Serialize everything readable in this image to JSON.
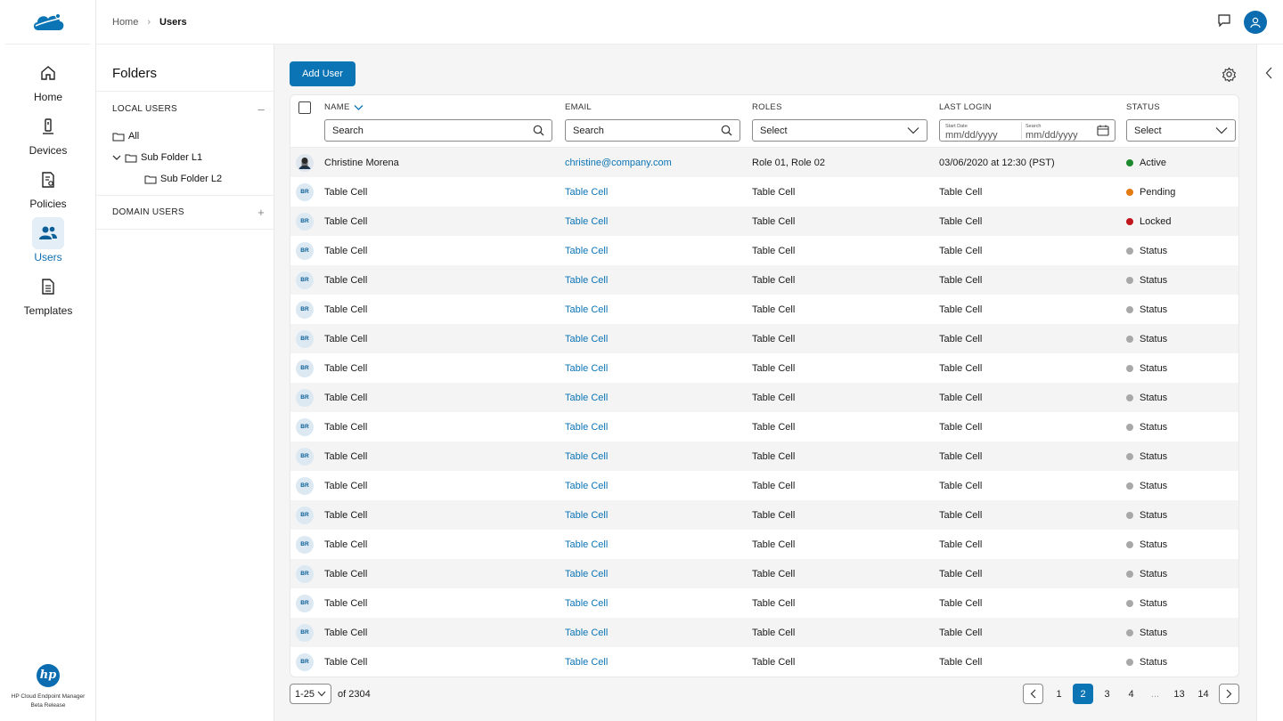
{
  "breadcrumb": {
    "home": "Home",
    "current": "Users"
  },
  "nav": {
    "items": [
      {
        "label": "Home",
        "icon": "home-icon"
      },
      {
        "label": "Devices",
        "icon": "device-icon"
      },
      {
        "label": "Policies",
        "icon": "policy-icon"
      },
      {
        "label": "Users",
        "icon": "users-icon",
        "active": true
      },
      {
        "label": "Templates",
        "icon": "template-icon"
      }
    ],
    "footer_line1": "HP Cloud Endpoint Manager",
    "footer_line2": "Beta Release",
    "footer_logo": "hp"
  },
  "folders": {
    "title": "Folders",
    "local_label": "LOCAL USERS",
    "local_toggle": "–",
    "nodes": [
      "All",
      "Sub Folder L1",
      "Sub Folder L2"
    ],
    "domain_label": "DOMAIN USERS",
    "domain_toggle": "+"
  },
  "toolbar": {
    "add_user": "Add User"
  },
  "table": {
    "headers": {
      "name": "NAME",
      "email": "EMAIL",
      "roles": "ROLES",
      "last_login": "LAST LOGIN",
      "status": "STATUS"
    },
    "filters": {
      "name": "Search",
      "email": "Search",
      "roles": "Select",
      "start_label": "Start Date",
      "start_value": "mm/dd/yyyy",
      "end_label": "Search",
      "end_value": "mm/dd/yyyy",
      "status": "Select"
    },
    "rows": [
      {
        "initials": "",
        "photo": true,
        "name": "Christine Morena",
        "email": "christine@company.com",
        "roles": "Role 01, Role 02",
        "last_login": "03/06/2020 at 12:30 (PST)",
        "status": "Active",
        "status_color": "#1e8a2e"
      },
      {
        "initials": "BR",
        "name": "Table Cell",
        "email": "Table Cell",
        "roles": "Table Cell",
        "last_login": "Table Cell",
        "status": "Pending",
        "status_color": "#e37a12"
      },
      {
        "initials": "BR",
        "name": "Table Cell",
        "email": "Table Cell",
        "roles": "Table Cell",
        "last_login": "Table Cell",
        "status": "Locked",
        "status_color": "#c0161c"
      },
      {
        "initials": "BR",
        "name": "Table Cell",
        "email": "Table Cell",
        "roles": "Table Cell",
        "last_login": "Table Cell",
        "status": "Status",
        "status_color": "#a8a8a8"
      },
      {
        "initials": "BR",
        "name": "Table Cell",
        "email": "Table Cell",
        "roles": "Table Cell",
        "last_login": "Table Cell",
        "status": "Status",
        "status_color": "#a8a8a8"
      },
      {
        "initials": "BR",
        "name": "Table Cell",
        "email": "Table Cell",
        "roles": "Table Cell",
        "last_login": "Table Cell",
        "status": "Status",
        "status_color": "#a8a8a8"
      },
      {
        "initials": "BR",
        "name": "Table Cell",
        "email": "Table Cell",
        "roles": "Table Cell",
        "last_login": "Table Cell",
        "status": "Status",
        "status_color": "#a8a8a8"
      },
      {
        "initials": "BR",
        "name": "Table Cell",
        "email": "Table Cell",
        "roles": "Table Cell",
        "last_login": "Table Cell",
        "status": "Status",
        "status_color": "#a8a8a8"
      },
      {
        "initials": "BR",
        "name": "Table Cell",
        "email": "Table Cell",
        "roles": "Table Cell",
        "last_login": "Table Cell",
        "status": "Status",
        "status_color": "#a8a8a8"
      },
      {
        "initials": "BR",
        "name": "Table Cell",
        "email": "Table Cell",
        "roles": "Table Cell",
        "last_login": "Table Cell",
        "status": "Status",
        "status_color": "#a8a8a8"
      },
      {
        "initials": "BR",
        "name": "Table Cell",
        "email": "Table Cell",
        "roles": "Table Cell",
        "last_login": "Table Cell",
        "status": "Status",
        "status_color": "#a8a8a8"
      },
      {
        "initials": "BR",
        "name": "Table Cell",
        "email": "Table Cell",
        "roles": "Table Cell",
        "last_login": "Table Cell",
        "status": "Status",
        "status_color": "#a8a8a8"
      },
      {
        "initials": "BR",
        "name": "Table Cell",
        "email": "Table Cell",
        "roles": "Table Cell",
        "last_login": "Table Cell",
        "status": "Status",
        "status_color": "#a8a8a8"
      },
      {
        "initials": "BR",
        "name": "Table Cell",
        "email": "Table Cell",
        "roles": "Table Cell",
        "last_login": "Table Cell",
        "status": "Status",
        "status_color": "#a8a8a8"
      },
      {
        "initials": "BR",
        "name": "Table Cell",
        "email": "Table Cell",
        "roles": "Table Cell",
        "last_login": "Table Cell",
        "status": "Status",
        "status_color": "#a8a8a8"
      },
      {
        "initials": "BR",
        "name": "Table Cell",
        "email": "Table Cell",
        "roles": "Table Cell",
        "last_login": "Table Cell",
        "status": "Status",
        "status_color": "#a8a8a8"
      },
      {
        "initials": "BR",
        "name": "Table Cell",
        "email": "Table Cell",
        "roles": "Table Cell",
        "last_login": "Table Cell",
        "status": "Status",
        "status_color": "#a8a8a8"
      },
      {
        "initials": "BR",
        "name": "Table Cell",
        "email": "Table Cell",
        "roles": "Table Cell",
        "last_login": "Table Cell",
        "status": "Status",
        "status_color": "#a8a8a8"
      }
    ]
  },
  "pagination": {
    "range": "1-25",
    "total": "of 2304",
    "pages": [
      "1",
      "2",
      "3",
      "4",
      "...",
      "13",
      "14"
    ],
    "current": "2"
  },
  "colors": {
    "brand": "#0b74b5",
    "active_nav_bg": "#e3eef7"
  }
}
